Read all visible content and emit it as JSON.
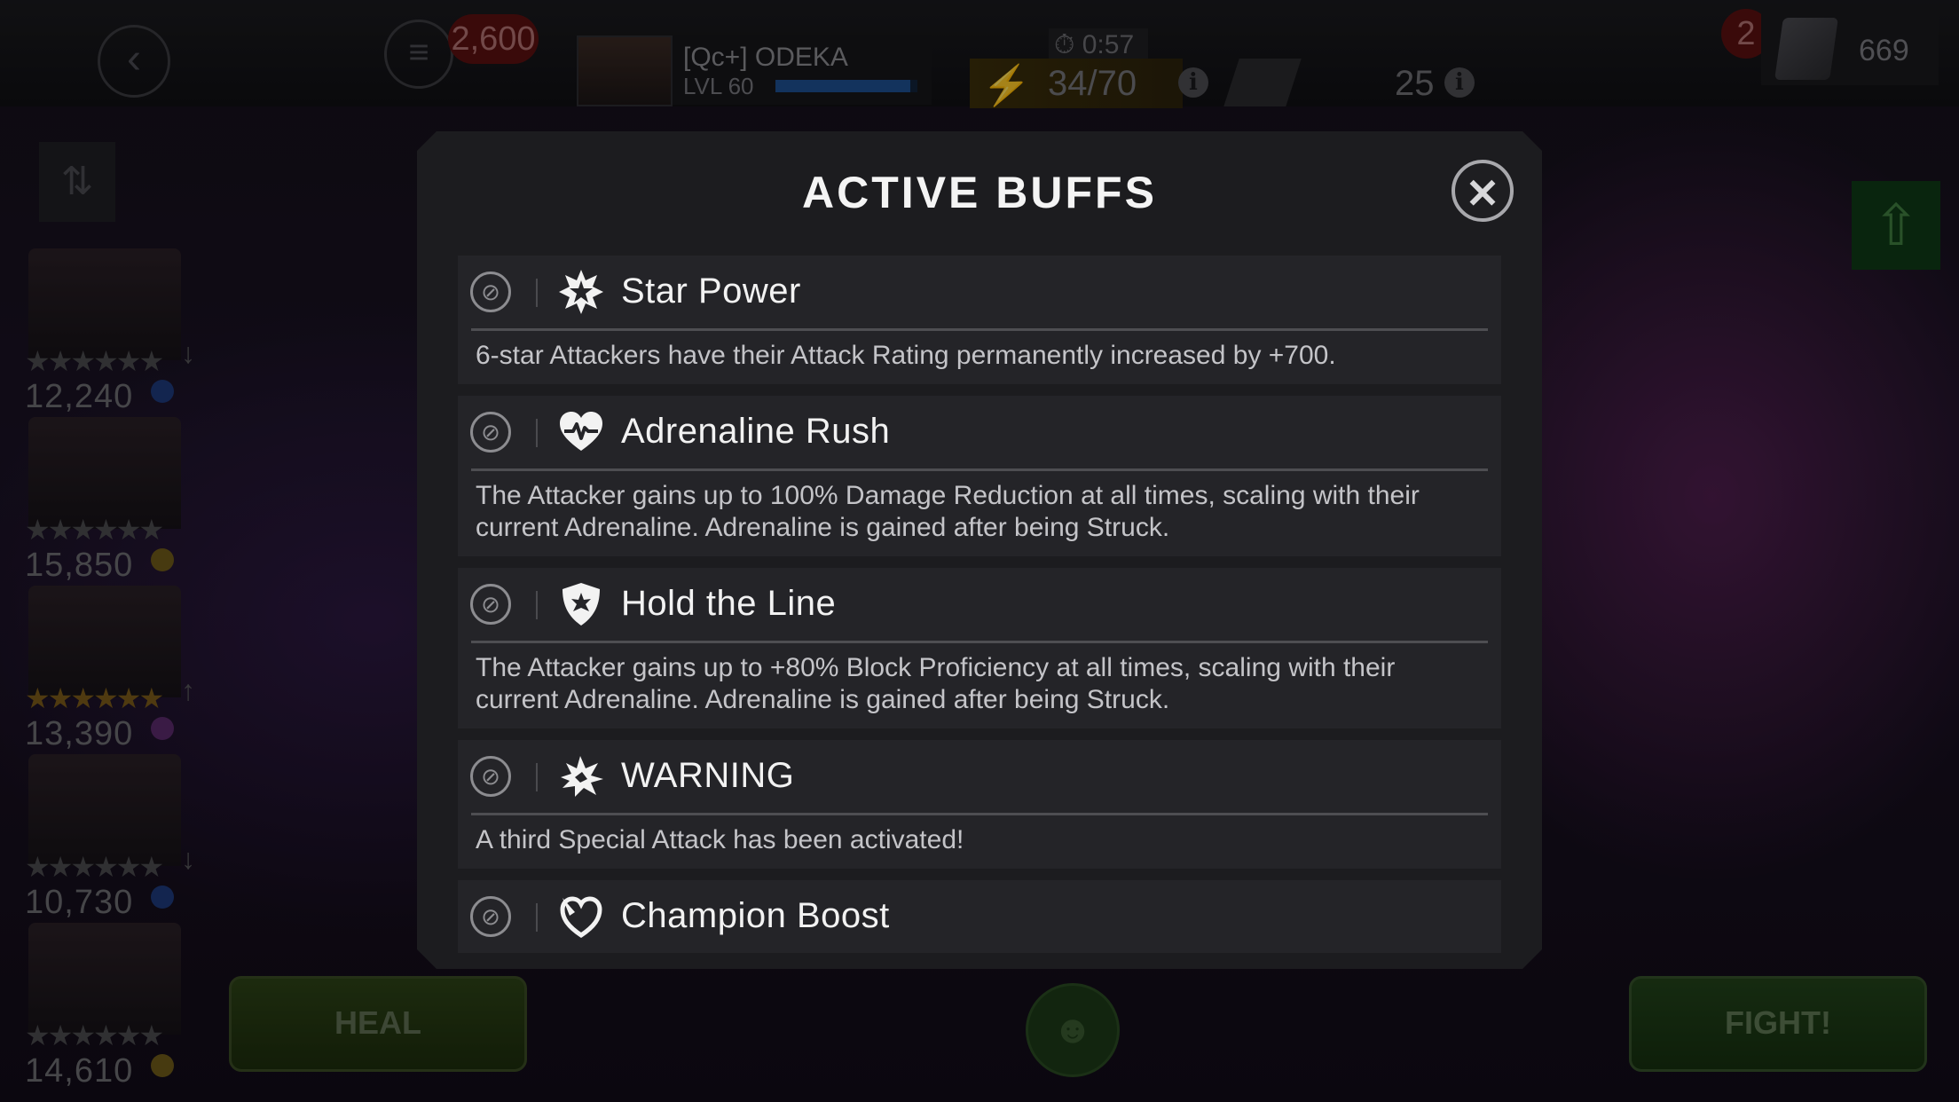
{
  "top_bar": {
    "back_icon": "chevron-left-icon",
    "menu_icon": "menu-icon",
    "units_count": "2,600",
    "player": {
      "name": "[Qc+] ODEKA",
      "level": "LVL 60",
      "xp_fraction": 0.95
    },
    "energy": {
      "timer": "0:57",
      "count": "34/70",
      "icon": "lightning-icon"
    },
    "tickets": {
      "count": "25",
      "icon": "ticket-icon"
    },
    "crystals": {
      "badge": "2",
      "count": "669",
      "icon": "crystal-icon"
    }
  },
  "roster": [
    {
      "rating": "12,240",
      "stars": "★★★★★★",
      "star_color": "grey",
      "arrow": "↓",
      "class_color": "#1e3a7a"
    },
    {
      "rating": "15,850",
      "stars": "★★★★★★",
      "star_color": "grey",
      "arrow": "",
      "class_color": "#6e5a1a"
    },
    {
      "rating": "13,390",
      "stars": "★★★★★★",
      "star_color": "gold",
      "arrow": "↑",
      "class_color": "#5a2a6a"
    },
    {
      "rating": "10,730",
      "stars": "★★★★★★",
      "star_color": "grey",
      "arrow": "↓",
      "class_color": "#1e3a7a"
    },
    {
      "rating": "14,610",
      "stars": "★★★★★★",
      "star_color": "grey",
      "arrow": "",
      "class_color": "#6e5a1a"
    }
  ],
  "modal": {
    "title": "ACTIVE BUFFS",
    "close_icon": "close-icon",
    "buffs": [
      {
        "name": "Star Power",
        "icon": "star-burst-icon",
        "description": "6-star Attackers have their Attack Rating permanently increased by +700."
      },
      {
        "name": "Adrenaline Rush",
        "icon": "heartbeat-icon",
        "description": "The Attacker gains up to 100% Damage Reduction at all times, scaling with their current Adrenaline. Adrenaline is gained after being Struck."
      },
      {
        "name": "Hold the Line",
        "icon": "shield-icon",
        "description": "The Attacker gains up to +80% Block Proficiency at all times, scaling with their current Adrenaline. Adrenaline is gained after being Struck."
      },
      {
        "name": "WARNING",
        "icon": "warning-burst-icon",
        "description": "A third Special Attack has been activated!"
      },
      {
        "name": "Champion Boost",
        "icon": "champion-boost-icon",
        "description": ""
      }
    ]
  },
  "bottom": {
    "heal_label": "HEAL",
    "fight_label": "FIGHT!"
  }
}
